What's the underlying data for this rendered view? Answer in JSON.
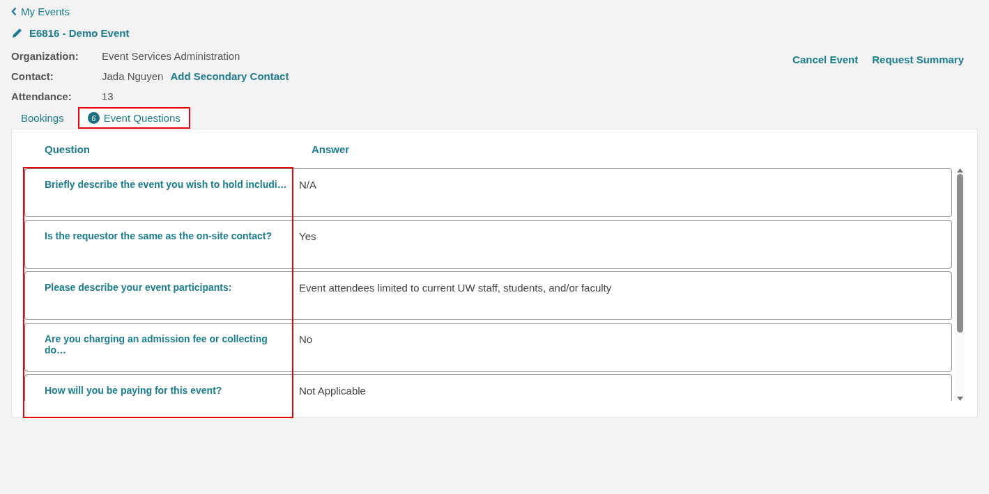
{
  "back_link": "My Events",
  "event_title": "E6816 - Demo Event",
  "details": [
    {
      "label": "Organization:",
      "value": "Event Services Administration"
    },
    {
      "label": "Contact:",
      "value": "Jada Nguyen",
      "action": "Add Secondary Contact"
    },
    {
      "label": "Attendance:",
      "value": "13"
    }
  ],
  "actions": [
    "Cancel Event",
    "Request Summary"
  ],
  "tabs": [
    {
      "label": "Bookings",
      "selected": false,
      "highlighted": false
    },
    {
      "label": "Event Questions",
      "badge": "6",
      "selected": true,
      "highlighted": true
    }
  ],
  "table": {
    "columns": [
      "Question",
      "Answer"
    ],
    "question_column_highlighted": true,
    "rows": [
      {
        "question": "Briefly describe the event you wish to hold includi…",
        "answer": "N/A"
      },
      {
        "question": "Is the requestor the same as the on-site contact?",
        "answer": "Yes"
      },
      {
        "question": "Please describe your event participants:",
        "answer": "Event attendees limited to current UW staff, students, and/or faculty"
      },
      {
        "question": "Are you charging an admission fee or collecting do…",
        "answer": "No"
      },
      {
        "question": "How will you be paying for this event?",
        "answer": "Not Applicable"
      }
    ]
  }
}
